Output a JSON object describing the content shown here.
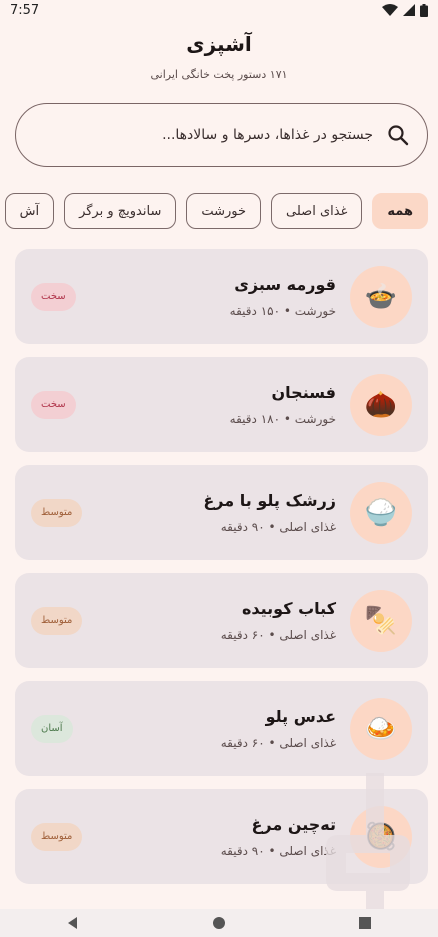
{
  "status": {
    "time": "7:57"
  },
  "header": {
    "title": "آشپزی",
    "subtitle": "۱۷۱ دستور پخت خانگی ایرانی"
  },
  "search": {
    "placeholder": "جستجو در غذاها، دسرها و سالادها..."
  },
  "filters": [
    {
      "label": "همه",
      "active": true
    },
    {
      "label": "غذای اصلی",
      "active": false
    },
    {
      "label": "خورشت",
      "active": false
    },
    {
      "label": "ساندویچ و برگر",
      "active": false
    },
    {
      "label": "آش",
      "active": false
    }
  ],
  "recipes": [
    {
      "title": "قورمه سبزی",
      "meta": "خورشت • ۱۵۰ دقیقه",
      "difficulty": "سخت",
      "icon": "stew-pot-icon",
      "emoji": "🍲",
      "badge_bg": "#f3cfd3",
      "badge_fg": "#b0344a"
    },
    {
      "title": "فسنجان",
      "meta": "خورشت • ۱۸۰ دقیقه",
      "difficulty": "سخت",
      "icon": "chestnut-icon",
      "emoji": "🌰",
      "badge_bg": "#f3cfd3",
      "badge_fg": "#b0344a"
    },
    {
      "title": "زرشک پلو با مرغ",
      "meta": "غذای اصلی • ۹۰ دقیقه",
      "difficulty": "متوسط",
      "icon": "rice-bowl-icon",
      "emoji": "🍚",
      "badge_bg": "#f1d7c7",
      "badge_fg": "#a0603a"
    },
    {
      "title": "کباب کوبیده",
      "meta": "غذای اصلی • ۶۰ دقیقه",
      "difficulty": "متوسط",
      "icon": "skewer-icon",
      "emoji": "🍢",
      "badge_bg": "#f1d7c7",
      "badge_fg": "#a0603a"
    },
    {
      "title": "عدس پلو",
      "meta": "غذای اصلی • ۶۰ دقیقه",
      "difficulty": "آسان",
      "icon": "curry-rice-icon",
      "emoji": "🍛",
      "badge_bg": "#dce7dc",
      "badge_fg": "#4d7a4d"
    },
    {
      "title": "ته‌چین مرغ",
      "meta": "غذای اصلی • ۹۰ دقیقه",
      "difficulty": "متوسط",
      "icon": "paella-pan-icon",
      "emoji": "🥘",
      "badge_bg": "#f1d7c7",
      "badge_fg": "#a0603a"
    }
  ]
}
